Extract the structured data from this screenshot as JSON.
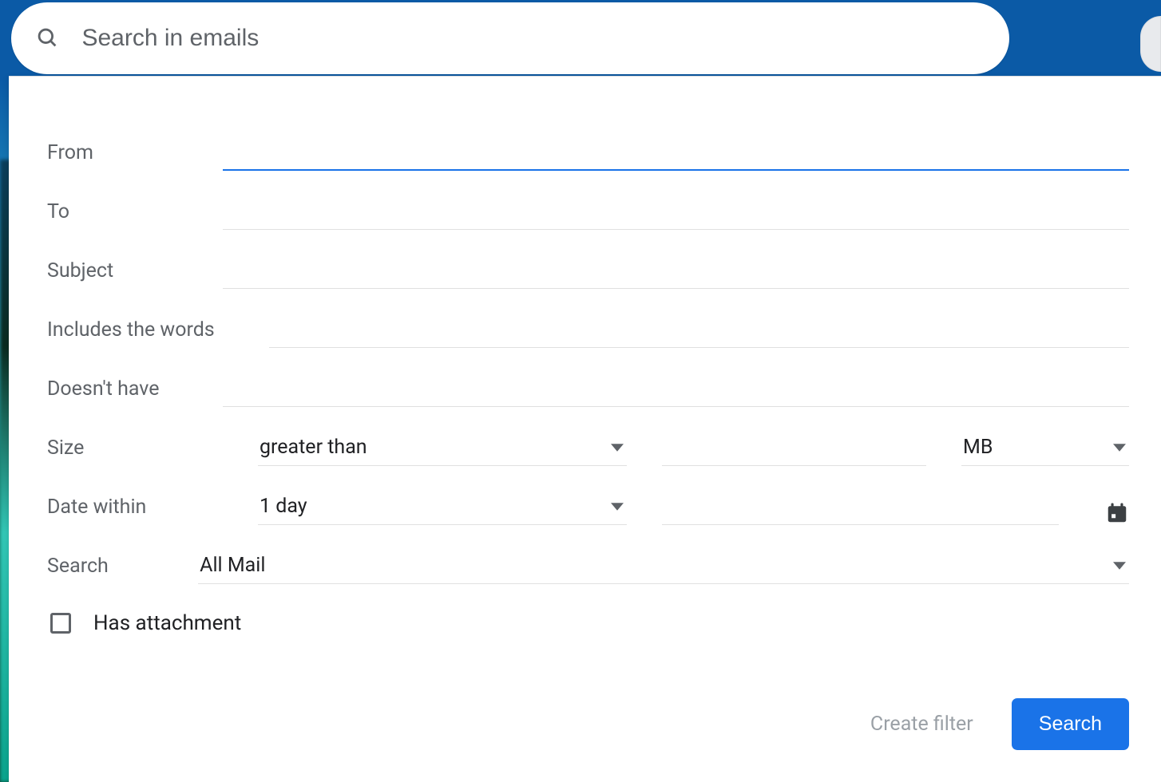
{
  "searchbar": {
    "placeholder": "Search in emails"
  },
  "form": {
    "from": {
      "label": "From",
      "value": ""
    },
    "to": {
      "label": "To",
      "value": ""
    },
    "subject": {
      "label": "Subject",
      "value": ""
    },
    "includes": {
      "label": "Includes the words",
      "value": ""
    },
    "doesnt": {
      "label": "Doesn't have",
      "value": ""
    },
    "size": {
      "label": "Size",
      "comparator": "greater than",
      "value": "",
      "unit": "MB"
    },
    "date": {
      "label": "Date within",
      "range": "1 day",
      "value": ""
    },
    "searchloc": {
      "label": "Search",
      "value": "All Mail"
    },
    "attachment": {
      "label": "Has attachment",
      "checked": false
    }
  },
  "footer": {
    "create_filter": "Create filter",
    "search": "Search"
  }
}
